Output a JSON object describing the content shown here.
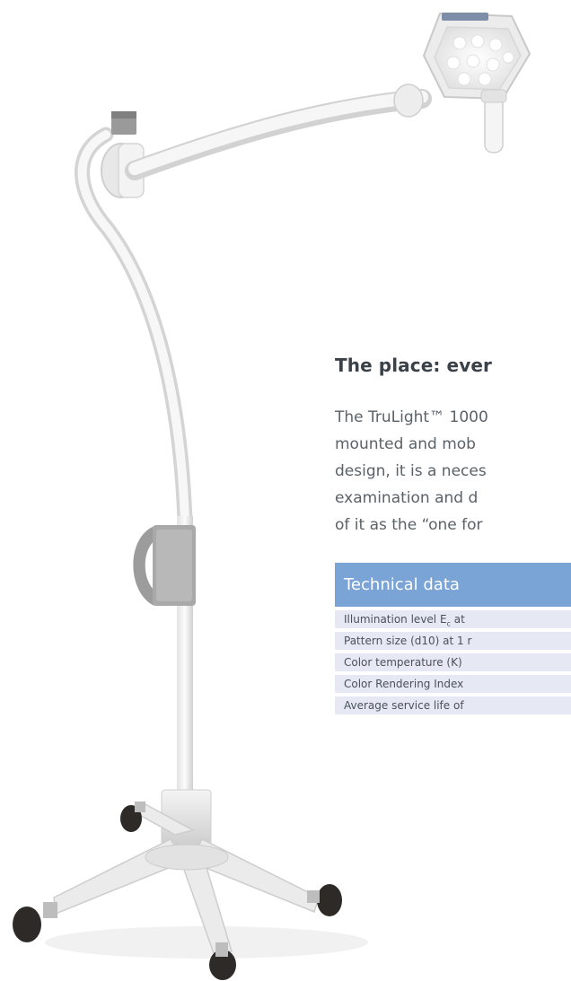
{
  "headline": "The place: ever",
  "body_lines": [
    "The TruLight™ 1000",
    "mounted and mob",
    "design, it is a neces",
    "examination and d",
    "of it as the “one for"
  ],
  "technical_data": {
    "title": "Technical data",
    "rows": [
      {
        "pre": "Illumination level E",
        "sub": "c",
        "post": " at"
      },
      {
        "pre": "Pattern size (d10) at 1 r",
        "sub": "",
        "post": ""
      },
      {
        "pre": "Color temperature (K)",
        "sub": "",
        "post": ""
      },
      {
        "pre": "Color Rendering Index",
        "sub": "",
        "post": ""
      },
      {
        "pre": "Average service life of",
        "sub": "",
        "post": ""
      }
    ]
  },
  "colors": {
    "table_header": "#7aa3d6",
    "table_row": "#e6e9f4",
    "headline": "#3a4148",
    "body_text": "#5a6268"
  },
  "icons": {
    "lamp_image": "mobile-examination-lamp-illustration"
  }
}
